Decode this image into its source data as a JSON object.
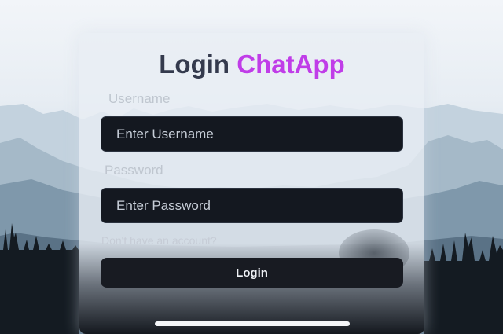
{
  "title": {
    "main": "Login",
    "app": "ChatApp"
  },
  "username": {
    "label": "Username",
    "placeholder": "Enter Username",
    "value": ""
  },
  "password": {
    "label": "Password",
    "placeholder": "Enter Password",
    "value": ""
  },
  "signup_link": {
    "label": "Don't have an account?"
  },
  "login_button": {
    "label": "Login"
  },
  "colors": {
    "title_main": "#343a4d",
    "title_app": "#c03de8",
    "field_background": "#141820",
    "button_background": "#181b22"
  },
  "background": {
    "icon": "mountain-forest-landscape"
  }
}
